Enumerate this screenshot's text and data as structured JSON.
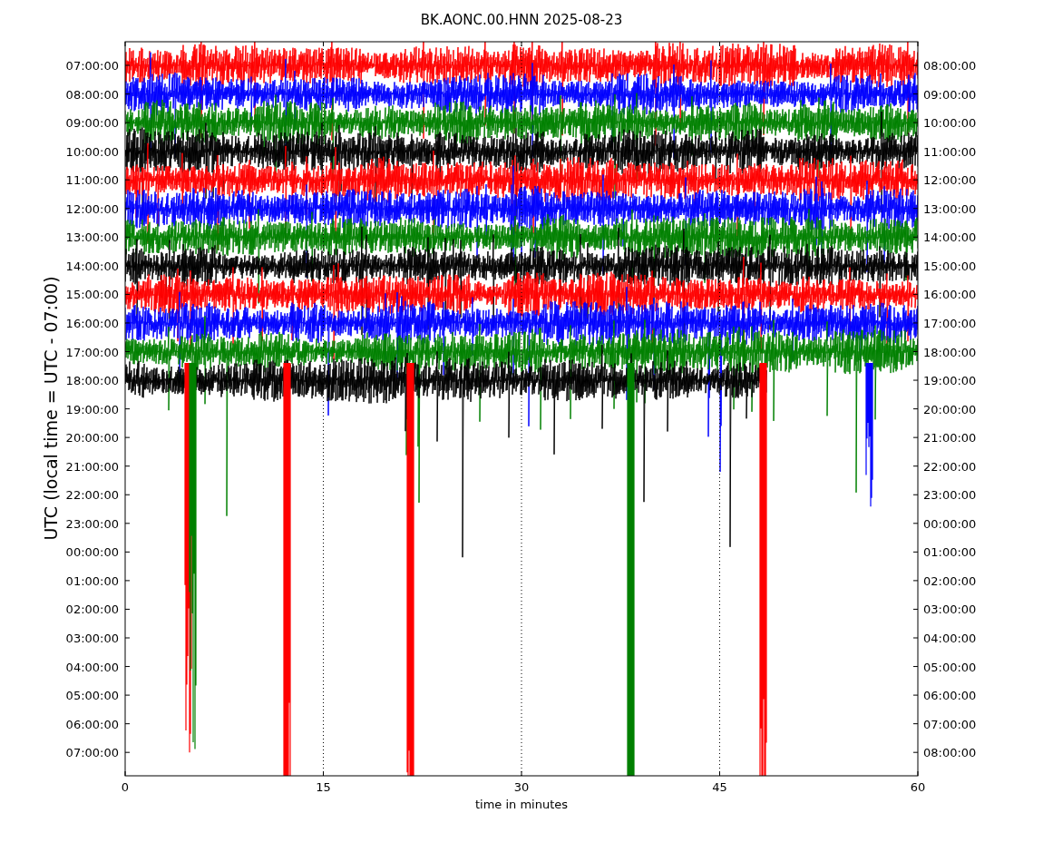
{
  "title": "BK.AONC.00.HNN 2025-08-23",
  "y_axis_label": "UTC (local time = UTC - 07:00)",
  "x_axis_label": "time in minutes",
  "left_ticks": [
    "07:00:00",
    "08:00:00",
    "09:00:00",
    "10:00:00",
    "11:00:00",
    "12:00:00",
    "13:00:00",
    "14:00:00",
    "15:00:00",
    "16:00:00",
    "17:00:00",
    "18:00:00",
    "19:00:00",
    "20:00:00",
    "21:00:00",
    "22:00:00",
    "23:00:00",
    "00:00:00",
    "01:00:00",
    "02:00:00",
    "03:00:00",
    "04:00:00",
    "05:00:00",
    "06:00:00",
    "07:00:00"
  ],
  "right_ticks": [
    "08:00:00",
    "09:00:00",
    "10:00:00",
    "11:00:00",
    "12:00:00",
    "13:00:00",
    "14:00:00",
    "15:00:00",
    "16:00:00",
    "17:00:00",
    "18:00:00",
    "19:00:00",
    "20:00:00",
    "21:00:00",
    "22:00:00",
    "23:00:00",
    "00:00:00",
    "01:00:00",
    "02:00:00",
    "03:00:00",
    "04:00:00",
    "05:00:00",
    "06:00:00",
    "07:00:00",
    "08:00:00"
  ],
  "x_ticks": [
    "0",
    "15",
    "30",
    "45",
    "60"
  ]
}
